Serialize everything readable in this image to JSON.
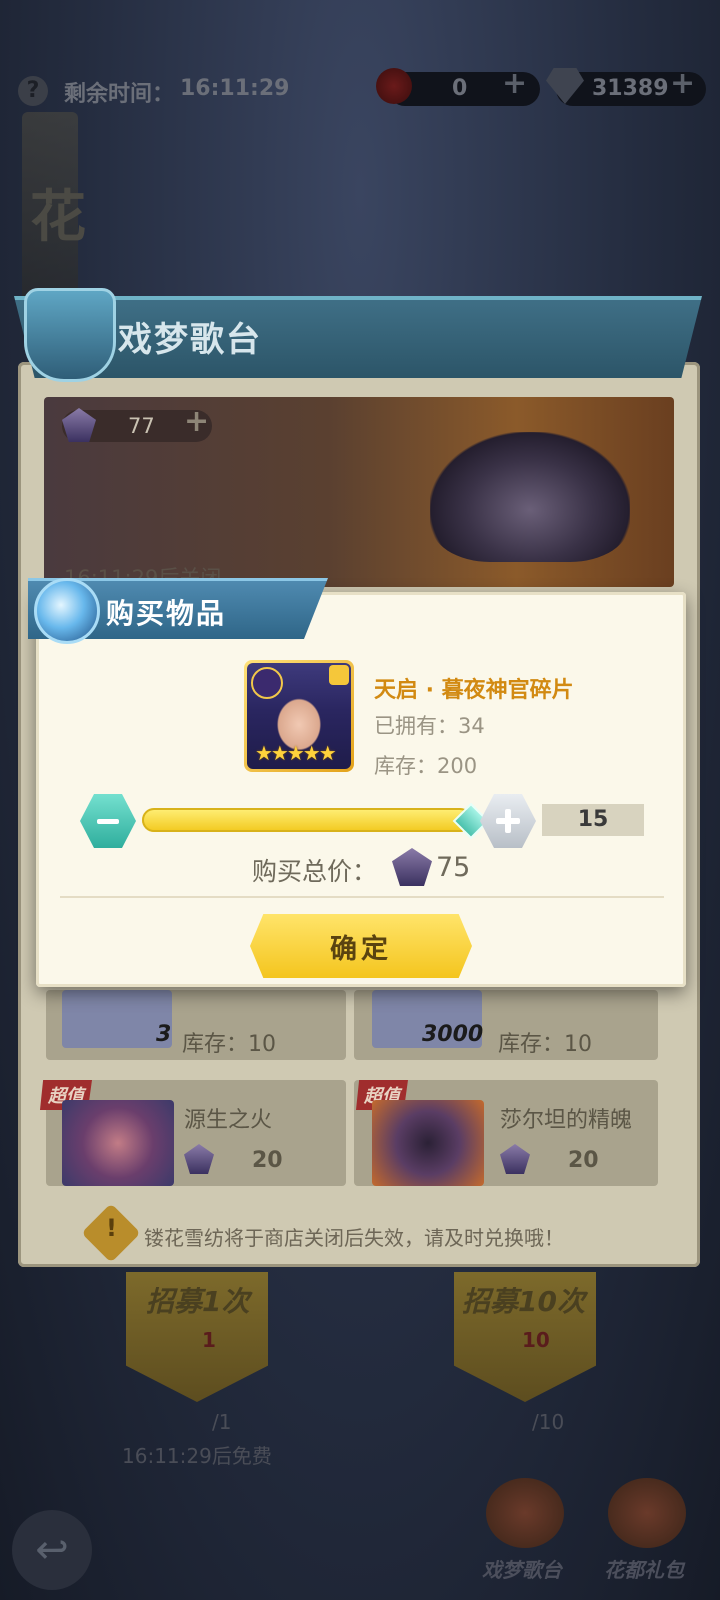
{
  "top_bar": {
    "help_icon": "question-icon",
    "time_label": "剩余时间：",
    "time_value": "16:11:29",
    "currency1_value": "0",
    "currency2_value": "31389"
  },
  "background": {
    "side_title_char1": "花",
    "banner_count": "77",
    "banner_close_text": "16:11:29后关闭",
    "shop_title": "戏梦歌台",
    "cards": [
      {
        "badge": "",
        "count": "3",
        "stock_label": "库存：10"
      },
      {
        "badge": "",
        "count": "3000",
        "stock_label": "库存：10"
      },
      {
        "badge": "超值",
        "name": "源生之火",
        "price": "20"
      },
      {
        "badge": "超值",
        "name": "莎尔坦的精魄",
        "price": "20"
      }
    ],
    "notice": "镂花雪纺将于商店关闭后失效，请及时兑换哦！",
    "recruit1": {
      "label": "招募1次",
      "cost": "1",
      "count": "/1",
      "free_text": "16:11:29后免费"
    },
    "recruit10": {
      "label": "招募10次",
      "cost": "10",
      "count": "/10"
    },
    "bottom_nav": [
      {
        "label": "戏梦歌台"
      },
      {
        "label": "花都礼包"
      }
    ]
  },
  "dialog": {
    "title": "购买物品",
    "item_name": "天启 · 暮夜神官碎片",
    "owned_label": "已拥有：34",
    "stock_label": "库存：200",
    "stars": "★★★★★",
    "quantity": "15",
    "slider_fraction": 1.0,
    "total_label": "购买总价：",
    "total_value": "75",
    "confirm_label": "确定"
  },
  "colors": {
    "accent_gold": "#f4c51e",
    "accent_teal": "#2fae9d",
    "dialog_bg": "#fbf8ea",
    "header_blue": "#2f6688"
  }
}
